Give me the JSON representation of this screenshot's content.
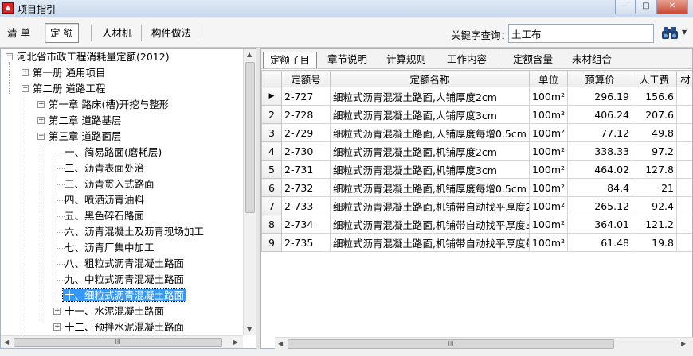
{
  "window": {
    "title": "项目指引",
    "app_icon": "app-icon",
    "buttons": {
      "minimize": "—",
      "maximize": "□",
      "close": "✕"
    }
  },
  "toolbar": {
    "tabs": [
      {
        "label": "清 单"
      },
      {
        "label": "定 额",
        "active": true
      },
      {
        "label": "人材机"
      },
      {
        "label": "构件做法"
      }
    ],
    "keyword_label": "关键字查询：",
    "keyword_value": "土工布",
    "search_icon": "binoculars-icon"
  },
  "tree": {
    "items": [
      {
        "label": "河北省市政工程消耗量定额(2012)",
        "expander": "−"
      },
      {
        "label": "第一册 通用项目",
        "expander": "+"
      },
      {
        "label": "第二册 道路工程",
        "expander": "−"
      },
      {
        "label": "第一章 路床(槽)开挖与整形",
        "expander": "+"
      },
      {
        "label": "第二章 道路基层",
        "expander": "+"
      },
      {
        "label": "第三章 道路面层",
        "expander": "−"
      },
      {
        "label": "一、简易路面(磨耗层)"
      },
      {
        "label": "二、沥青表面处治"
      },
      {
        "label": "三、沥青贯入式路面"
      },
      {
        "label": "四、喷洒沥青油料"
      },
      {
        "label": "五、黑色碎石路面"
      },
      {
        "label": "六、沥青混凝土及沥青现场加工"
      },
      {
        "label": "七、沥青厂集中加工"
      },
      {
        "label": "八、粗粒式沥青混凝土路面"
      },
      {
        "label": "九、中粒式沥青混凝土路面"
      },
      {
        "label": "十、细粒式沥青混凝土路面",
        "selected": true
      },
      {
        "label": "十一、水泥混凝土路面",
        "expander": "+"
      },
      {
        "label": "十二、预拌水泥混凝土路面",
        "expander": "+"
      }
    ]
  },
  "right_tabs": [
    {
      "label": "定额子目",
      "active": true
    },
    {
      "label": "章节说明"
    },
    {
      "label": "计算规则"
    },
    {
      "label": "工作内容"
    },
    {
      "label": "定额含量"
    },
    {
      "label": "未材组合"
    }
  ],
  "grid": {
    "columns": [
      "",
      "定额号",
      "定额名称",
      "单位",
      "预算价",
      "人工费",
      "材"
    ],
    "rows": [
      {
        "rn": "▶",
        "code": "2-727",
        "name": "细粒式沥青混凝土路面,人铺厚度2cm",
        "unit": "100m²",
        "price": "296.19",
        "labor": "156.6"
      },
      {
        "rn": "2",
        "code": "2-728",
        "name": "细粒式沥青混凝土路面,人铺厚度3cm",
        "unit": "100m²",
        "price": "406.24",
        "labor": "207.6"
      },
      {
        "rn": "3",
        "code": "2-729",
        "name": "细粒式沥青混凝土路面,人铺厚度每增0.5cm",
        "unit": "100m²",
        "price": "77.12",
        "labor": "49.8"
      },
      {
        "rn": "4",
        "code": "2-730",
        "name": "细粒式沥青混凝土路面,机铺厚度2cm",
        "unit": "100m²",
        "price": "338.33",
        "labor": "97.2"
      },
      {
        "rn": "5",
        "code": "2-731",
        "name": "细粒式沥青混凝土路面,机铺厚度3cm",
        "unit": "100m²",
        "price": "464.02",
        "labor": "127.8"
      },
      {
        "rn": "6",
        "code": "2-732",
        "name": "细粒式沥青混凝土路面,机铺厚度每增0.5cm",
        "unit": "100m²",
        "price": "84.4",
        "labor": "21"
      },
      {
        "rn": "7",
        "code": "2-733",
        "name": "细粒式沥青混凝土路面,机铺带自动找平厚度2c",
        "unit": "100m²",
        "price": "265.12",
        "labor": "92.4"
      },
      {
        "rn": "8",
        "code": "2-734",
        "name": "细粒式沥青混凝土路面,机铺带自动找平厚度3c",
        "unit": "100m²",
        "price": "364.01",
        "labor": "121.2"
      },
      {
        "rn": "9",
        "code": "2-735",
        "name": "细粒式沥青混凝土路面,机铺带自动找平厚度每:",
        "unit": "100m²",
        "price": "61.48",
        "labor": "19.8"
      }
    ]
  },
  "scroll": {
    "left_h_label": "III",
    "right_h_label": "III"
  }
}
